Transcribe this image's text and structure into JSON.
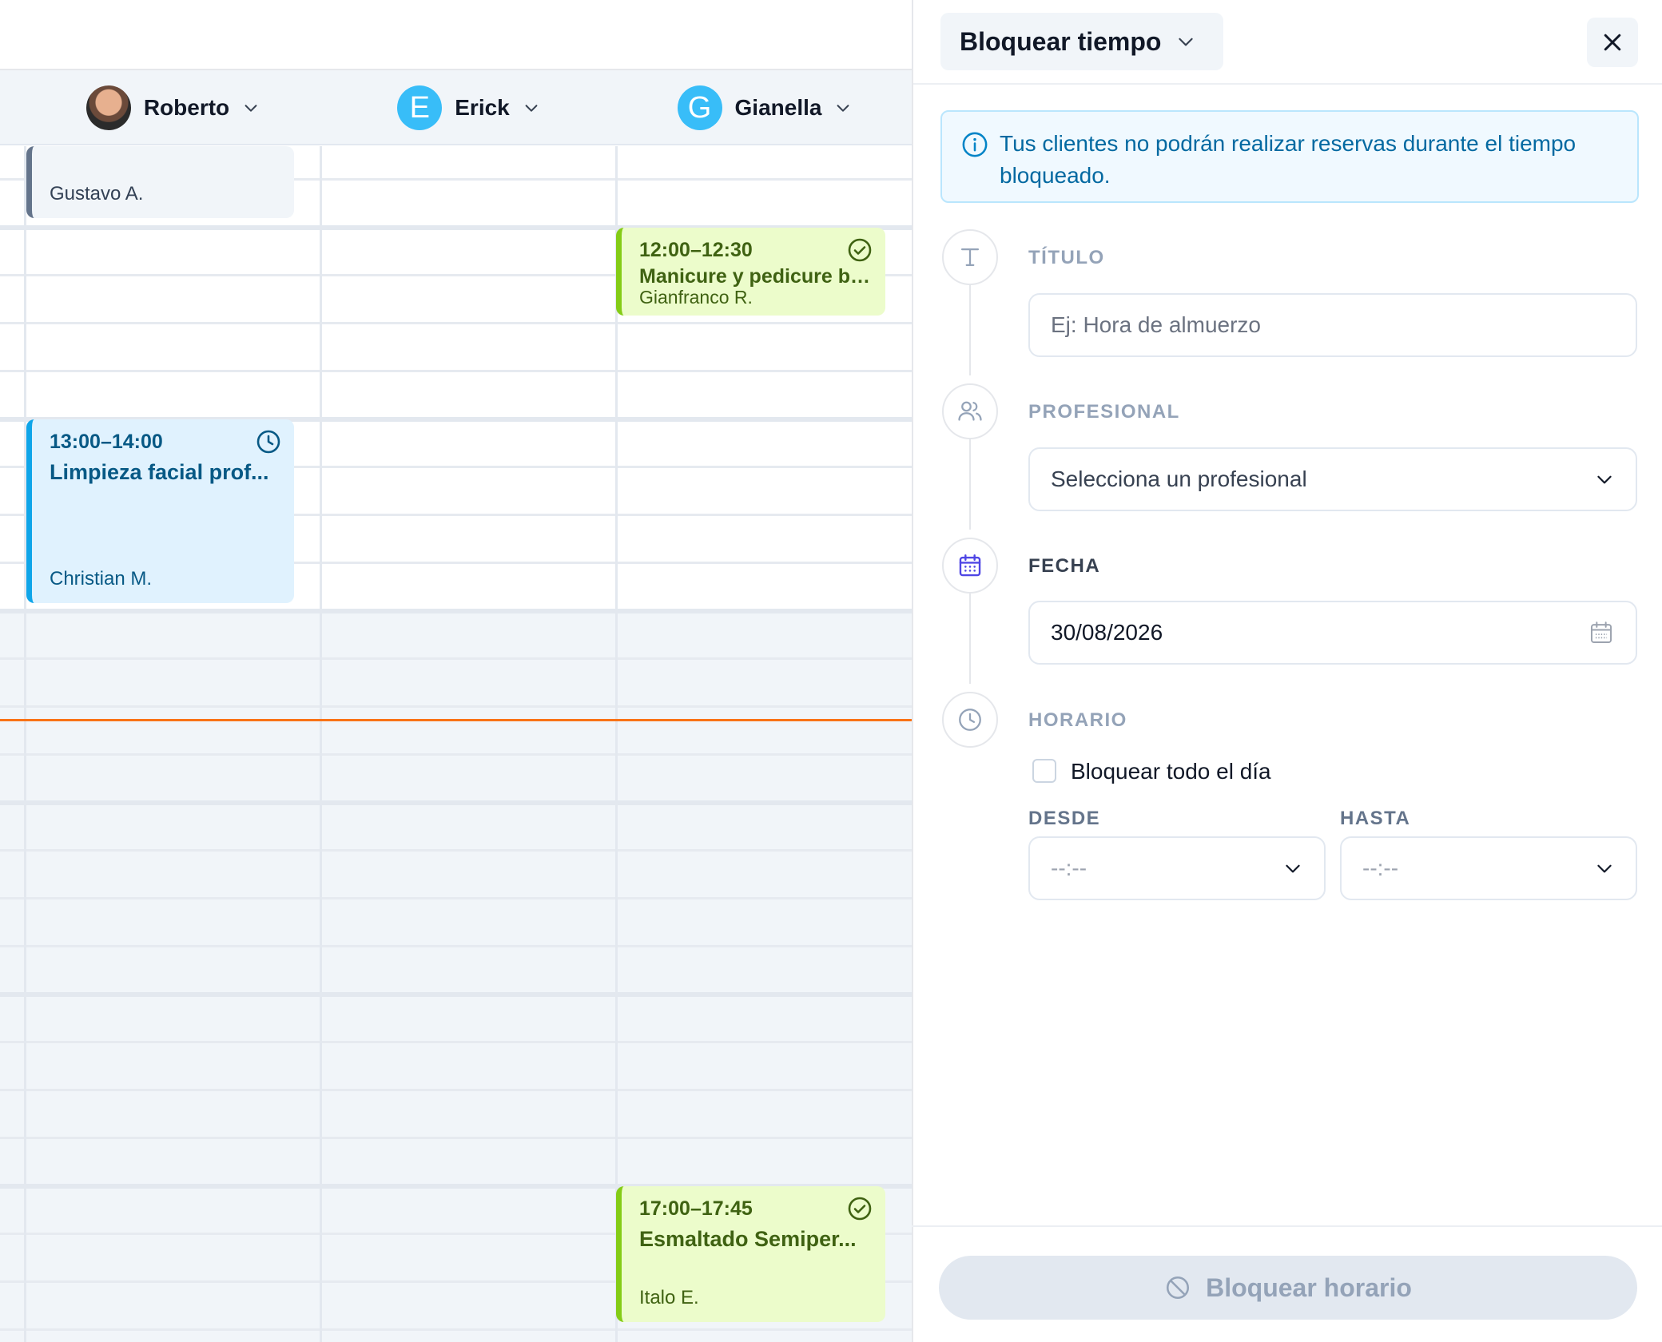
{
  "calendar": {
    "professionals": [
      {
        "name": "Roberto",
        "avatar": "photo"
      },
      {
        "name": "Erick",
        "avatar": "letter",
        "initial": "E",
        "color": "#38bdf8"
      },
      {
        "name": "Gianella",
        "avatar": "letter",
        "initial": "G",
        "color": "#38bdf8"
      }
    ],
    "events": [
      {
        "column": "Roberto",
        "client": "Gustavo A.",
        "color": "gray"
      },
      {
        "column": "Gianella",
        "time": "12:00–12:30",
        "title": "Manicure y pedicure bá...",
        "client": "Gianfranco R.",
        "status_icon": "check-circle-icon",
        "color": "green"
      },
      {
        "column": "Roberto",
        "time": "13:00–14:00",
        "title": "Limpieza facial prof...",
        "client": "Christian M.",
        "status_icon": "clock-icon",
        "color": "blue"
      },
      {
        "column": "Gianella",
        "time": "17:00–17:45",
        "title": "Esmaltado Semiper...",
        "client": "Italo E.",
        "status_icon": "check-circle-icon",
        "color": "green"
      }
    ],
    "colors": {
      "now_line": "#f97316",
      "green": "#84cc16",
      "blue": "#0ea5e9",
      "gray": "#64748b"
    }
  },
  "panel": {
    "title": "Bloquear tiempo",
    "info": "Tus clientes no podrán realizar reservas durante el tiempo bloqueado.",
    "titulo": {
      "label": "TÍTULO",
      "placeholder": "Ej: Hora de almuerzo"
    },
    "profesional": {
      "label": "PROFESIONAL",
      "placeholder": "Selecciona un profesional"
    },
    "fecha": {
      "label": "FECHA",
      "value": "30/08/2026"
    },
    "horario": {
      "label": "HORARIO",
      "all_day_label": "Bloquear todo el día",
      "all_day_checked": false,
      "desde": {
        "label": "DESDE",
        "value": "--:--"
      },
      "hasta": {
        "label": "HASTA",
        "value": "--:--"
      }
    },
    "submit_label": "Bloquear horario",
    "colors": {
      "accent": "#4f46e5",
      "info_text": "#0369a1",
      "info_bg": "#f0f9ff"
    }
  }
}
